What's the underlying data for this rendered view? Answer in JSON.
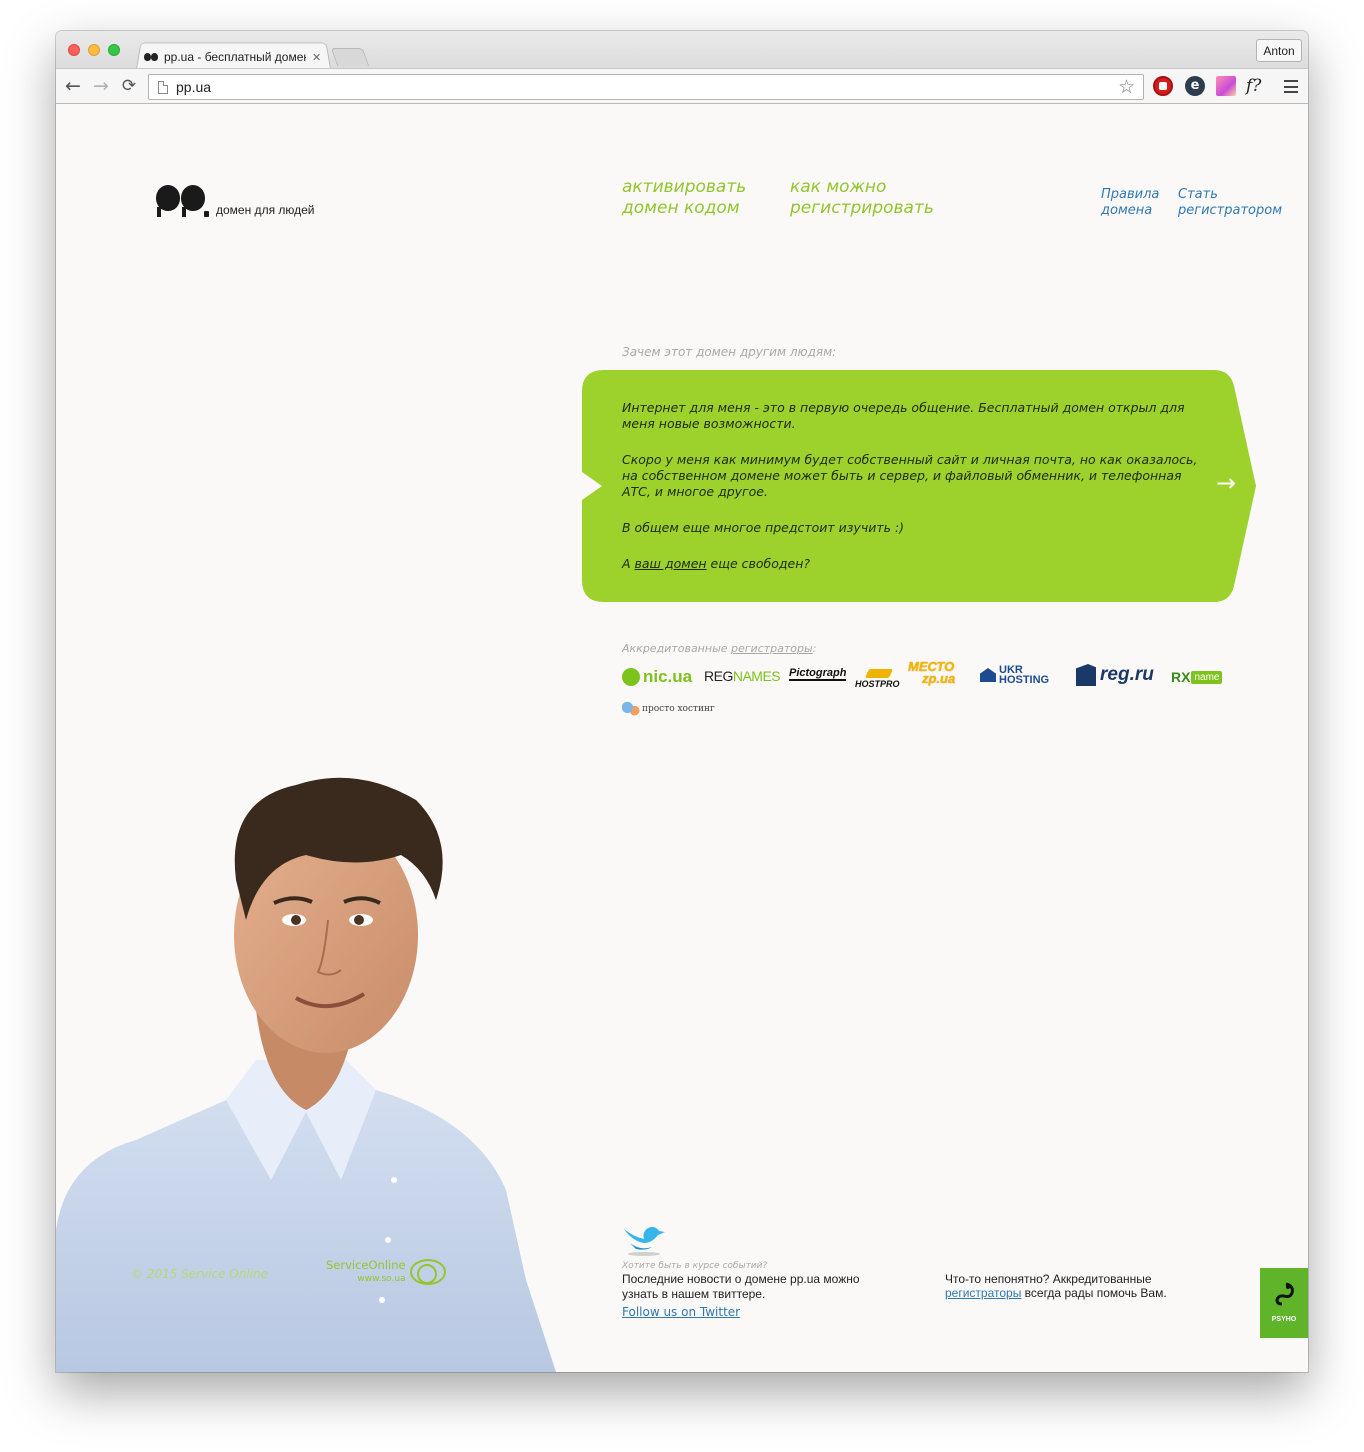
{
  "browser": {
    "tab_title": "pp.ua - бесплатный домен",
    "tab_close": "✕",
    "profile_name": "Anton",
    "url": "pp.ua",
    "back_icon": "←",
    "forward_icon": "→",
    "reload_icon": "⟳",
    "star_icon": "☆",
    "ext_icons": [
      "adblock-icon",
      "ghostery-icon",
      "color-picker-icon",
      "whatfont-icon"
    ],
    "ext_letters": {
      "ghostery": "e",
      "whatfont": "f?"
    }
  },
  "header": {
    "logo_text": "домен для людей",
    "nav_green": [
      {
        "line1": "активировать",
        "line2": "домен кодом"
      },
      {
        "line1": "как можно",
        "line2": "регистрировать"
      }
    ],
    "nav_blue": [
      {
        "line1": "Правила",
        "line2": "домена"
      },
      {
        "line1": "Стать",
        "line2": "регистратором"
      }
    ]
  },
  "testimonial": {
    "question": "Зачем этот домен другим людям:",
    "paragraphs": [
      "Интернет для меня - это в первую очередь общение. Бесплатный домен открыл для меня новые возможности.",
      "Скоро у меня как минимум будет собственный сайт и личная почта, но как оказалось, на собственном домене может быть и сервер, и файловый обменник, и телефонная АТС, и многое другое.",
      "В общем еще многое предстоит изучить :)"
    ],
    "cta_prefix": "А ",
    "cta_link": "ваш домен",
    "cta_suffix": " еще свободен?",
    "next_arrow": "→",
    "bubble_color": "#9dd12b"
  },
  "registrars": {
    "label_prefix": "Аккредитованные ",
    "label_link": "регистраторы",
    "label_suffix": ":",
    "logos": {
      "nic": "nic.ua",
      "regnames_a": "REG",
      "regnames_b": "NAMES",
      "pictograph": "Pictograph",
      "hostpro": "HOSTPRO",
      "mesto_1": "МЕСТО",
      "mesto_2": "zp.ua",
      "ukr_1": "UKR",
      "ukr_2": "HOSTING",
      "regru": "reg.ru",
      "rx": "RX",
      "rx_name": "name",
      "prosto": "просто хостинг"
    }
  },
  "footer": {
    "copyright": "© 2015 Service Online",
    "so_name": "ServiceOnline",
    "so_url": "www.so.ua",
    "twitter_question": "Хотите быть в курсе событий?",
    "twitter_text": "Последние новости о домене pp.ua можно узнать в нашем твиттере.",
    "twitter_link": "Follow us on Twitter",
    "help_prefix": "Что-то непонятно? Аккредитованные ",
    "help_link": "регистраторы",
    "help_suffix": " всегда рады помочь Вам.",
    "psyho_label": "PSYHO"
  },
  "colors": {
    "accent_green": "#93c52e",
    "link_blue": "#2f78b2",
    "page_bg": "#faf9f7"
  }
}
